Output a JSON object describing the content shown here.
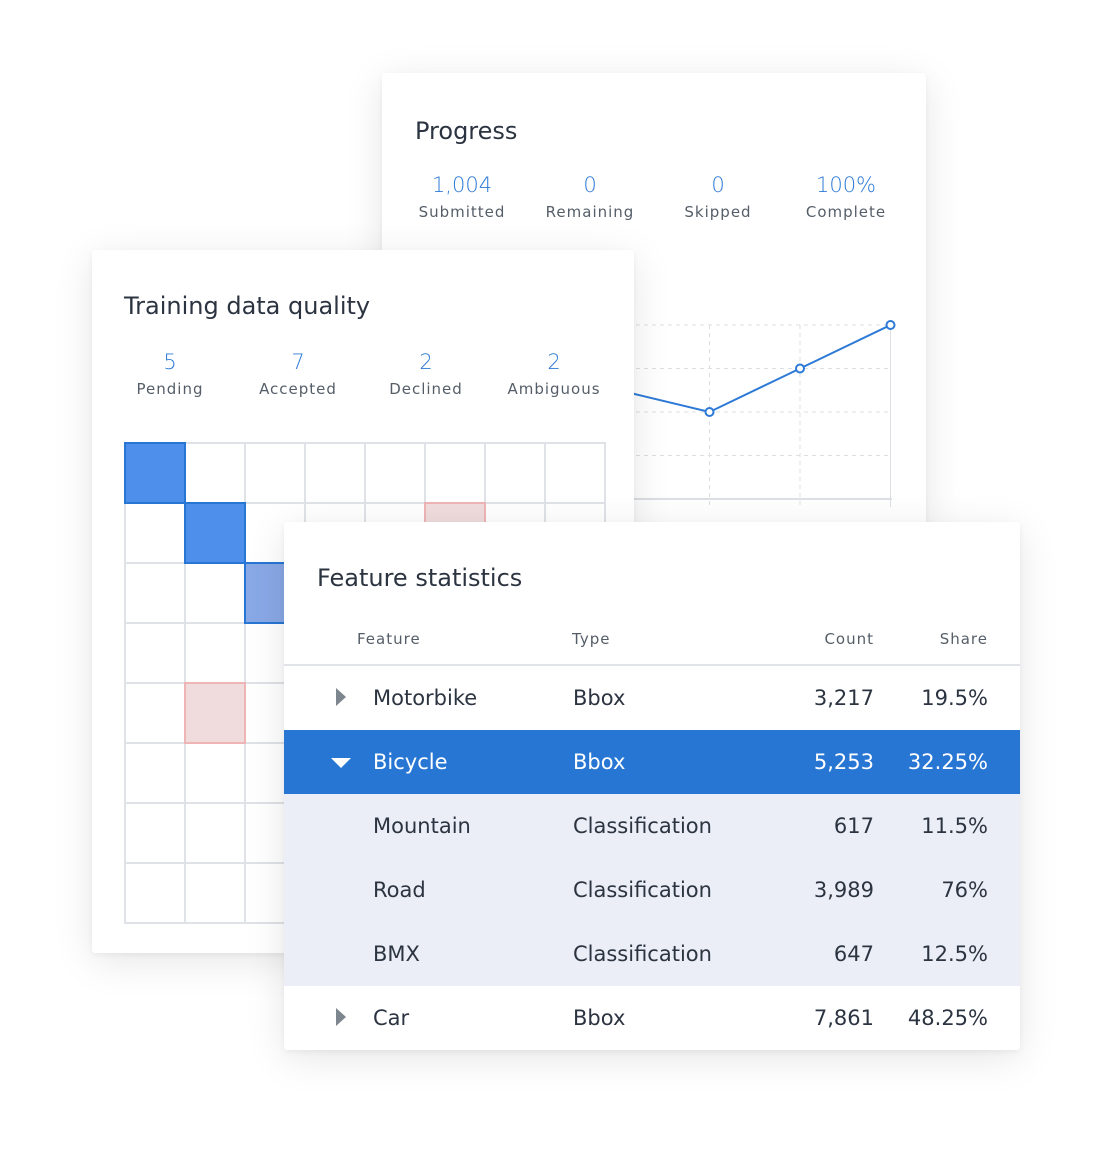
{
  "progress": {
    "title": "Progress",
    "stats": [
      {
        "value": "1,004",
        "label": "Submitted"
      },
      {
        "value": "0",
        "label": "Remaining"
      },
      {
        "value": "0",
        "label": "Skipped"
      },
      {
        "value": "100%",
        "label": "Complete"
      }
    ]
  },
  "quality": {
    "title": "Training data quality",
    "stats": [
      {
        "value": "5",
        "label": "Pending"
      },
      {
        "value": "7",
        "label": "Accepted"
      },
      {
        "value": "2",
        "label": "Declined"
      },
      {
        "value": "2",
        "label": "Ambiguous"
      }
    ],
    "matrix": {
      "size": 8,
      "cells": [
        {
          "row": 0,
          "col": 0,
          "status": "accepted"
        },
        {
          "row": 1,
          "col": 1,
          "status": "accepted"
        },
        {
          "row": 2,
          "col": 2,
          "status": "pending"
        },
        {
          "row": 1,
          "col": 5,
          "status": "declined"
        },
        {
          "row": 4,
          "col": 1,
          "status": "declined"
        }
      ]
    }
  },
  "chart_data": {
    "type": "line",
    "values": [
      2.5,
      2,
      3,
      4
    ],
    "ylim": [
      0,
      4
    ],
    "grid": true,
    "color": "#2d7ad6"
  },
  "features": {
    "title": "Feature statistics",
    "headers": {
      "feature": "Feature",
      "type": "Type",
      "count": "Count",
      "share": "Share"
    },
    "rows": [
      {
        "feature": "Motorbike",
        "type": "Bbox",
        "count": "3,217",
        "share": "19.5%",
        "kind": "collapsed"
      },
      {
        "feature": "Bicycle",
        "type": "Bbox",
        "count": "5,253",
        "share": "32.25%",
        "kind": "expanded"
      },
      {
        "feature": "Mountain",
        "type": "Classification",
        "count": "617",
        "share": "11.5%",
        "kind": "child"
      },
      {
        "feature": "Road",
        "type": "Classification",
        "count": "3,989",
        "share": "76%",
        "kind": "child"
      },
      {
        "feature": "BMX",
        "type": "Classification",
        "count": "647",
        "share": "12.5%",
        "kind": "child"
      },
      {
        "feature": "Car",
        "type": "Bbox",
        "count": "7,861",
        "share": "48.25%",
        "kind": "collapsed"
      }
    ]
  },
  "colors": {
    "accent": "#2776d4",
    "accepted": "#4f8fec",
    "pending": "#89a8e6",
    "declined": "#f0dcdd"
  }
}
